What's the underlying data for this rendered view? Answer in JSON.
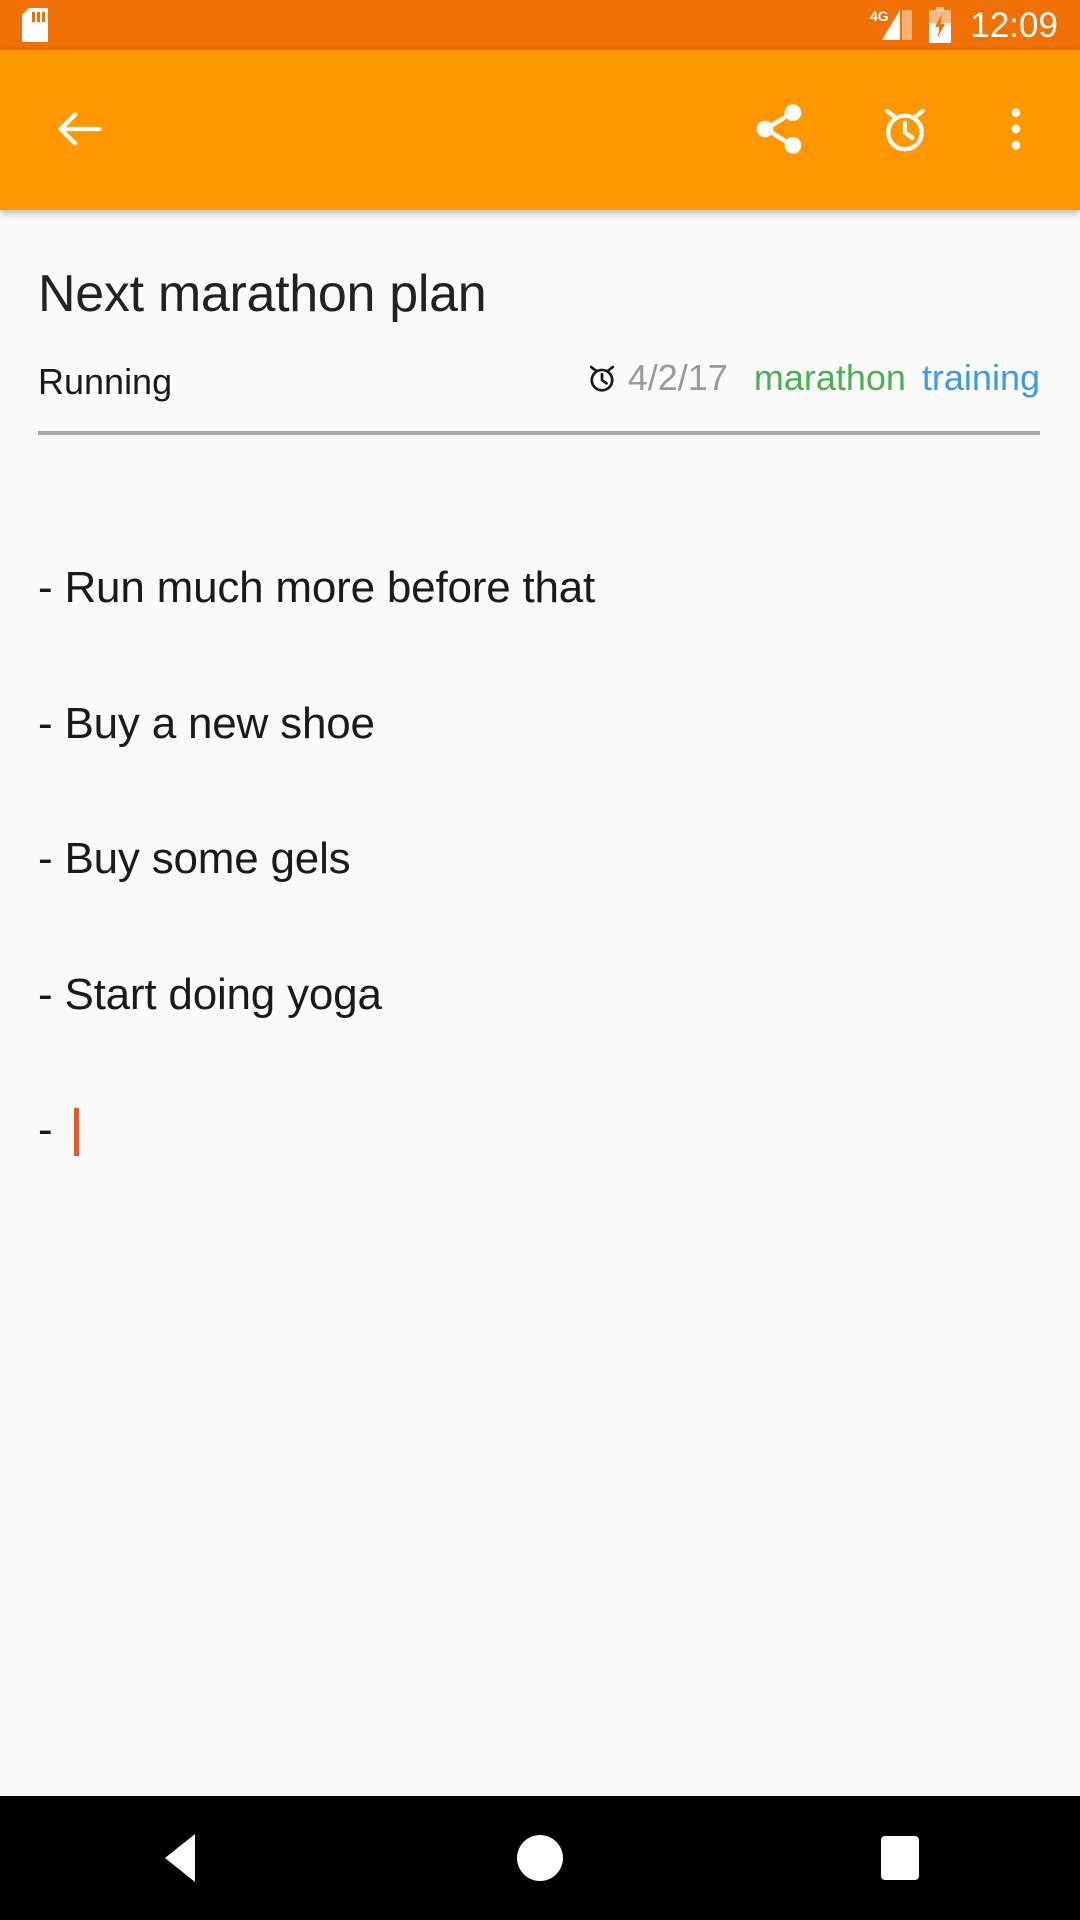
{
  "status_bar": {
    "sd_card_icon": "sd-card-icon",
    "network_label": "4G",
    "signal_icon": "signal-bars-icon",
    "battery_icon": "battery-charging-icon",
    "time": "12:09",
    "background_color": "#ef7004"
  },
  "app_bar": {
    "background_color": "#ff9800",
    "back_icon": "arrow-back-icon",
    "share_icon": "share-icon",
    "alarm_icon": "alarm-clock-icon",
    "overflow_icon": "more-vertical-icon"
  },
  "note": {
    "title": "Next marathon plan",
    "category": "Running",
    "reminder_icon": "alarm-clock-icon",
    "reminder_date": "4/2/17",
    "tags": [
      {
        "label": "marathon",
        "color": "#4caf50"
      },
      {
        "label": "training",
        "color": "#3c9ae8"
      }
    ],
    "body_lines": [
      "- Run much more before that",
      "- Buy a new shoe",
      "- Buy some gels",
      "- Start doing yoga",
      "- "
    ],
    "caret_color": "#e8562a",
    "background_color": "#fafafa"
  },
  "nav_bar": {
    "background_color": "#000000",
    "back_icon": "nav-back-triangle-icon",
    "home_icon": "nav-home-circle-icon",
    "recents_icon": "nav-recents-square-icon"
  }
}
